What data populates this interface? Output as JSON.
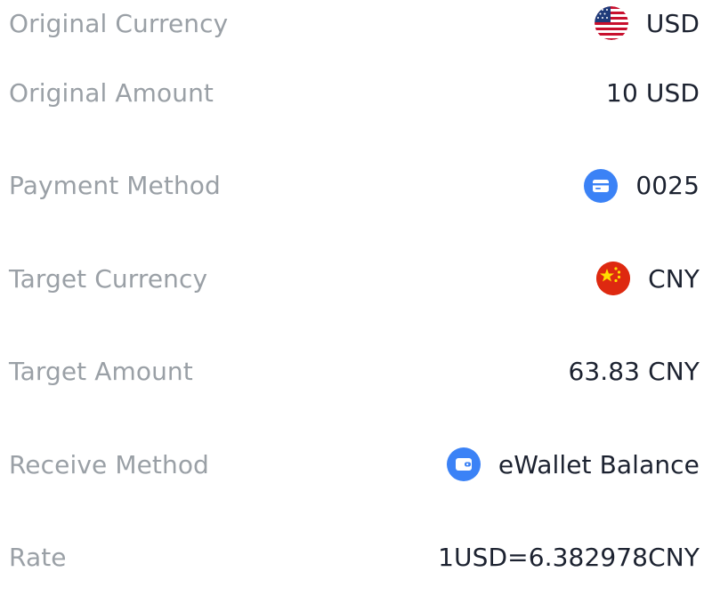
{
  "details": [
    {
      "label": "Original Currency",
      "value": "USD",
      "icon": "us-flag-icon"
    },
    {
      "label": "Original Amount",
      "value": "10 USD",
      "icon": null
    },
    {
      "label": "Payment Method",
      "value": "0025",
      "icon": "card-icon"
    },
    {
      "label": "Target Currency",
      "value": "CNY",
      "icon": "cn-flag-icon"
    },
    {
      "label": "Target Amount",
      "value": "63.83 CNY",
      "icon": null
    },
    {
      "label": "Receive Method",
      "value": "eWallet Balance",
      "icon": "wallet-icon"
    },
    {
      "label": "Rate",
      "value": "1USD=6.382978CNY",
      "icon": null
    }
  ],
  "colors": {
    "label": "#9aa0a6",
    "value": "#1c2230",
    "icon_blue": "#3b82f6",
    "cn_red": "#de2910",
    "cn_star": "#ffde00"
  }
}
